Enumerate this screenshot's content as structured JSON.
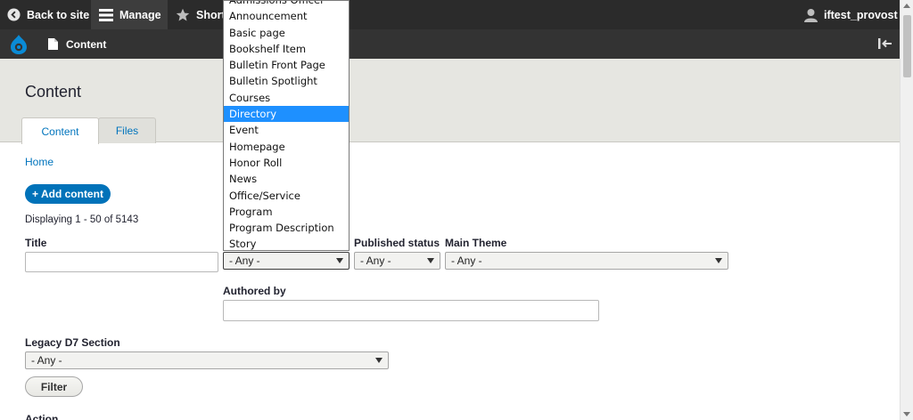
{
  "toolbar": {
    "back_label": "Back to site",
    "manage_label": "Manage",
    "shortcuts_label": "Shortcuts",
    "user_label": "iftest_provost"
  },
  "tray": {
    "content_label": "Content"
  },
  "page": {
    "title": "Content",
    "tabs": [
      {
        "label": "Content",
        "active": true
      },
      {
        "label": "Files",
        "active": false
      }
    ],
    "breadcrumb": "Home",
    "add_button": "+ Add content",
    "count_text": "Displaying 1 - 50 of 5143"
  },
  "filters": {
    "title_label": "Title",
    "title_value": "",
    "content_type_value": "- Any -",
    "published_label": "Published status",
    "published_value": "- Any -",
    "main_theme_label": "Main Theme",
    "main_theme_value": "- Any -",
    "authored_label": "Authored by",
    "authored_value": "",
    "legacy_label": "Legacy D7 Section",
    "legacy_value": "- Any -",
    "filter_button": "Filter",
    "action_label": "Action"
  },
  "dropdown": {
    "options": [
      "Admissions Officer",
      "Announcement",
      "Basic page",
      "Bookshelf Item",
      "Bulletin Front Page",
      "Bulletin Spotlight",
      "Courses",
      "Directory",
      "Event",
      "Homepage",
      "Honor Roll",
      "News",
      "Office/Service",
      "Program",
      "Program Description",
      "Story"
    ],
    "selected": "Directory"
  },
  "colors": {
    "toolbar_bg": "#2b2b2b",
    "tray_bg": "#333333",
    "header_bg": "#e6e6e1",
    "accent": "#0072b9",
    "highlight": "#1e90ff"
  }
}
